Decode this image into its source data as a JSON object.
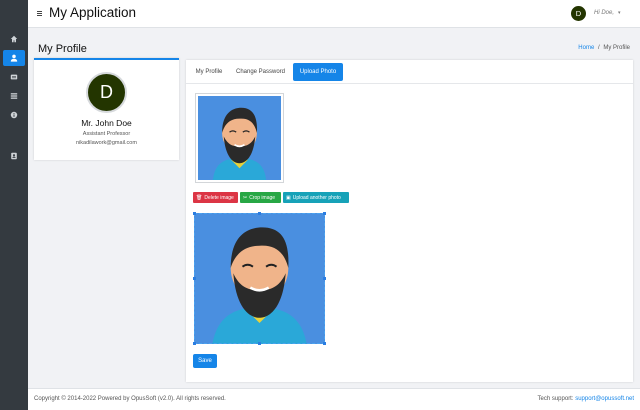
{
  "app": {
    "title": "My Application",
    "hamburger_icon": "menu-icon"
  },
  "user_menu": {
    "avatar_letter": "D",
    "greeting": "Hi Doe,",
    "caret": "▾"
  },
  "sidebar": {
    "items": [
      {
        "icon": "home-icon",
        "active": false
      },
      {
        "icon": "user-icon",
        "active": true
      },
      {
        "icon": "id-card-icon",
        "active": false
      },
      {
        "icon": "list-icon",
        "active": false
      },
      {
        "icon": "info-icon",
        "active": false
      },
      {
        "icon": "contact-card-icon",
        "active": false
      }
    ]
  },
  "page": {
    "title": "My Profile"
  },
  "breadcrumb": {
    "home": "Home",
    "separator": "/",
    "current": "My Profile"
  },
  "profile": {
    "avatar_letter": "D",
    "name": "Mr. John Doe",
    "role": "Assistant Professor",
    "email": "nikadilawork@gmail.com"
  },
  "tabs": [
    {
      "label": "My Profile",
      "active": false
    },
    {
      "label": "Change Password",
      "active": false
    },
    {
      "label": "Upload Photo",
      "active": true
    }
  ],
  "actions": {
    "delete_label": "Delete image",
    "crop_label": "Crop image",
    "upload_label": "Upload another photo",
    "save_label": "Save"
  },
  "footer": {
    "copyright": "Copyright © 2014-2022 Powered by OpusSoft (v2.0). All rights reserved.",
    "support_label": "Tech support:",
    "support_email": "support@opussoft.net"
  },
  "colors": {
    "primary": "#1585e8",
    "danger": "#dc3545",
    "success": "#28a745",
    "info": "#17a2b8",
    "sidebar": "#343a40",
    "avatar": "#233500"
  }
}
